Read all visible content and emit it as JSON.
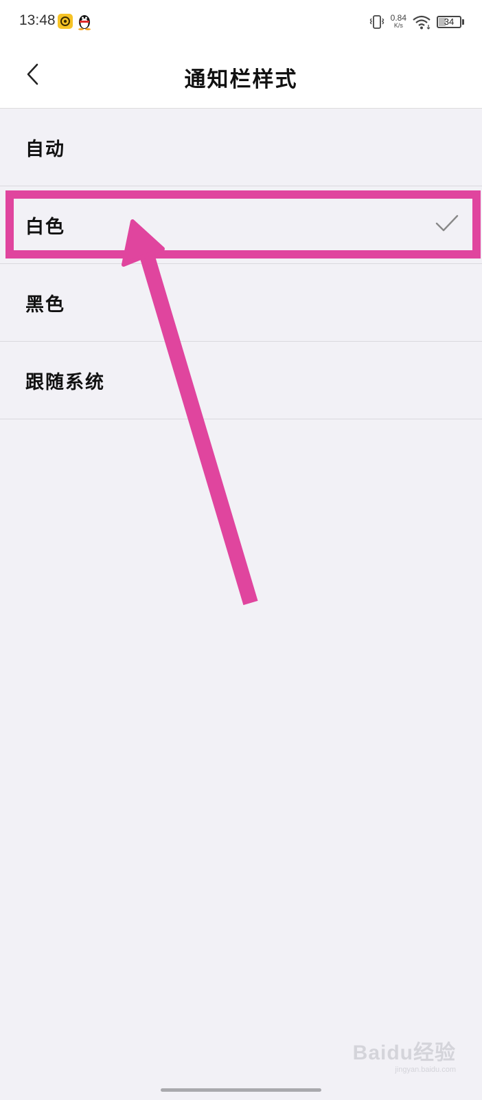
{
  "status_bar": {
    "time": "13:48",
    "net_speed_value": "0.84",
    "net_speed_unit": "K/s",
    "battery_level": "34",
    "battery_fraction": 0.34
  },
  "icons": {
    "status_app": "app-notification-icon",
    "qq": "qq-penguin-icon",
    "vibrate": "vibrate-icon",
    "wifi": "wifi-icon",
    "battery": "battery-icon",
    "back": "chevron-left-icon",
    "check": "check-icon"
  },
  "header": {
    "title": "通知栏样式"
  },
  "options": [
    {
      "label": "自动",
      "selected": false
    },
    {
      "label": "白色",
      "selected": true
    },
    {
      "label": "黑色",
      "selected": false
    },
    {
      "label": "跟随系统",
      "selected": false
    }
  ],
  "watermark": {
    "logo": "Baidu经验",
    "url": "jingyan.baidu.com"
  },
  "colors": {
    "background": "#f2f1f6",
    "header_background": "#ffffff",
    "annotation": "#e0459e",
    "text": "#111111",
    "check": "#888888"
  }
}
